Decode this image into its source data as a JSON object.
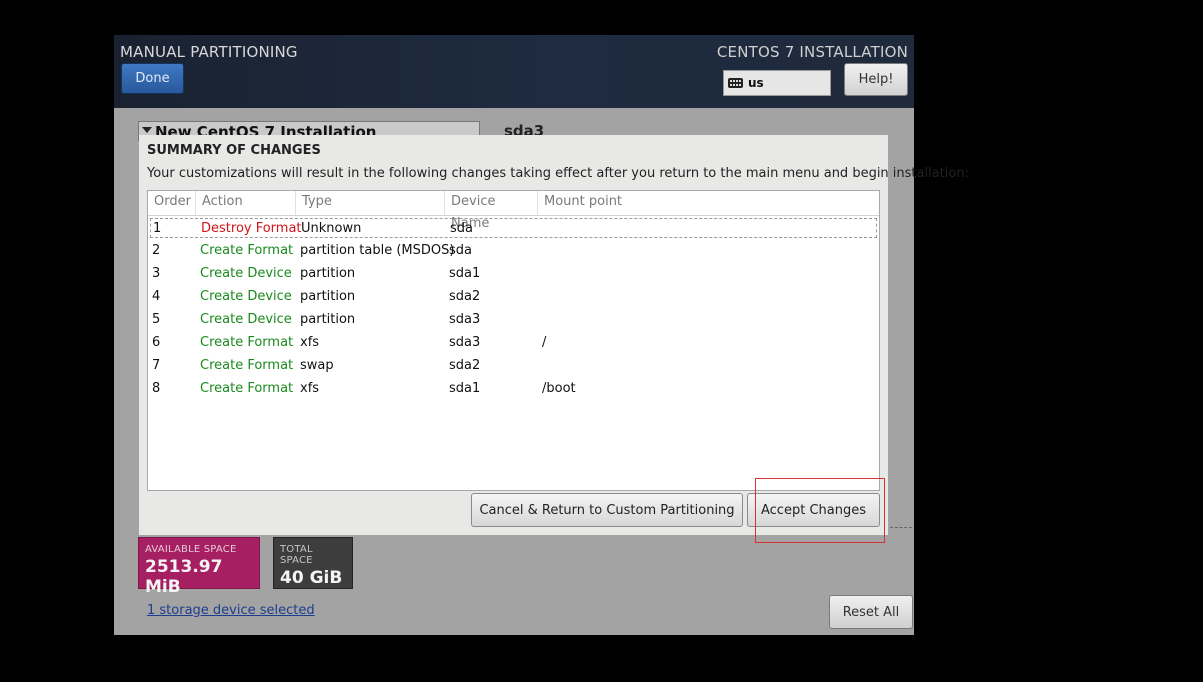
{
  "header": {
    "spoke_title": "MANUAL PARTITIONING",
    "done_label": "Done",
    "product_title": "CENTOS 7 INSTALLATION",
    "keyboard_layout": "us",
    "help_label": "Help!"
  },
  "background": {
    "installation_label": "New CentOS 7 Installation",
    "selected_partition": "sda3",
    "available_space_label": "AVAILABLE SPACE",
    "available_space_value": "2513.97 MiB",
    "total_space_label": "TOTAL SPACE",
    "total_space_value": "40 GiB",
    "storage_link": "1 storage device selected",
    "reset_label": "Reset All"
  },
  "dialog": {
    "title": "SUMMARY OF CHANGES",
    "description": "Your customizations will result in the following changes taking effect after you return to the main menu and begin installation:",
    "columns": [
      "Order",
      "Action",
      "Type",
      "Device Name",
      "Mount point"
    ],
    "rows": [
      {
        "order": "1",
        "action": "Destroy Format",
        "type": "Unknown",
        "device": "sda",
        "mount": ""
      },
      {
        "order": "2",
        "action": "Create Format",
        "type": "partition table (MSDOS)",
        "device": "sda",
        "mount": ""
      },
      {
        "order": "3",
        "action": "Create Device",
        "type": "partition",
        "device": "sda1",
        "mount": ""
      },
      {
        "order": "4",
        "action": "Create Device",
        "type": "partition",
        "device": "sda2",
        "mount": ""
      },
      {
        "order": "5",
        "action": "Create Device",
        "type": "partition",
        "device": "sda3",
        "mount": ""
      },
      {
        "order": "6",
        "action": "Create Format",
        "type": "xfs",
        "device": "sda3",
        "mount": "/"
      },
      {
        "order": "7",
        "action": "Create Format",
        "type": "swap",
        "device": "sda2",
        "mount": ""
      },
      {
        "order": "8",
        "action": "Create Format",
        "type": "xfs",
        "device": "sda1",
        "mount": "/boot"
      }
    ],
    "cancel_label": "Cancel & Return to Custom Partitioning",
    "accept_label": "Accept Changes"
  },
  "colors": {
    "destroy": "#d0161b",
    "create": "#198a1c",
    "available_space": "#a61f62",
    "total_space": "#3d3d3d",
    "highlight": "#d93232"
  }
}
